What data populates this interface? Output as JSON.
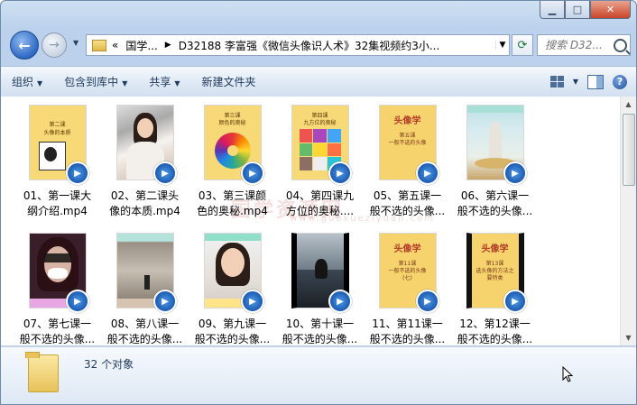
{
  "window": {
    "caption_min": "▁",
    "caption_max": "□",
    "caption_close": "✕"
  },
  "nav": {
    "back_glyph": "←",
    "forward_glyph": "→",
    "history_glyph": "▼",
    "refresh_glyph": "⟳",
    "breadcrumb_prefix": "«",
    "breadcrumb_parent": "国学...",
    "breadcrumb_separator": "▶",
    "breadcrumb_current": "D32188 李富强《微信头像识人术》32集视频约3小...",
    "dropdown_glyph": "▼",
    "search_placeholder": "搜索 D32..."
  },
  "toolbar": {
    "organize": "组织",
    "include_in_library": "包含到库中",
    "share": "共享",
    "new_folder": "新建文件夹",
    "arrow": "▼",
    "help": "?"
  },
  "files": [
    {
      "line1": "01、第一课大",
      "line2": "纲介绍.mp4",
      "thumb": "yellow-class",
      "thumb_title": "第二课",
      "thumb_sub": "头像的本质"
    },
    {
      "line1": "02、第二课头",
      "line2": "像的本质.mp4",
      "thumb": "photo-woman"
    },
    {
      "line1": "03、第三课颜",
      "line2": "色的奥秘.mp4",
      "thumb": "color-wheel",
      "thumb_title": "第三课",
      "thumb_sub": "颜色的奥秘"
    },
    {
      "line1": "04、第四课九",
      "line2": "方位的奥秘....",
      "thumb": "nine-grid",
      "thumb_title": "第四课",
      "thumb_sub": "九方位的奥秘"
    },
    {
      "line1": "05、第五课一",
      "line2": "般不选的头像...",
      "thumb": "head-yellow",
      "thumb_title": "头像学",
      "thumb_sub": "第五课\n一般不选的头像"
    },
    {
      "line1": "06、第六课一",
      "line2": "般不选的头像...",
      "thumb": "statue"
    },
    {
      "line1": "07、第七课一",
      "line2": "般不选的头像...",
      "thumb": "mask"
    },
    {
      "line1": "08、第八课一",
      "line2": "般不选的头像...",
      "thumb": "cliff"
    },
    {
      "line1": "09、第九课一",
      "line2": "般不选的头像...",
      "thumb": "photo-girl"
    },
    {
      "line1": "10、第十课一",
      "line2": "般不选的头像...",
      "thumb": "sea"
    },
    {
      "line1": "11、第11课一",
      "line2": "般不选的头像...",
      "thumb": "head-yellow",
      "thumb_title": "头像学",
      "thumb_sub": "第11课\n一般不选的头像\n(七)"
    },
    {
      "line1": "12、第12课一",
      "line2": "般不选的头像...",
      "thumb": "head-yellow-dark",
      "thumb_title": "头像学",
      "thumb_sub": "第13课\n选头像的方法之\n要特类"
    }
  ],
  "watermark": "国学资源网",
  "watermark_url": "www.guoxueziyuan.com",
  "status": {
    "count": "32 个对象"
  },
  "scrollbar": {
    "up": "▲",
    "down": "▼"
  }
}
